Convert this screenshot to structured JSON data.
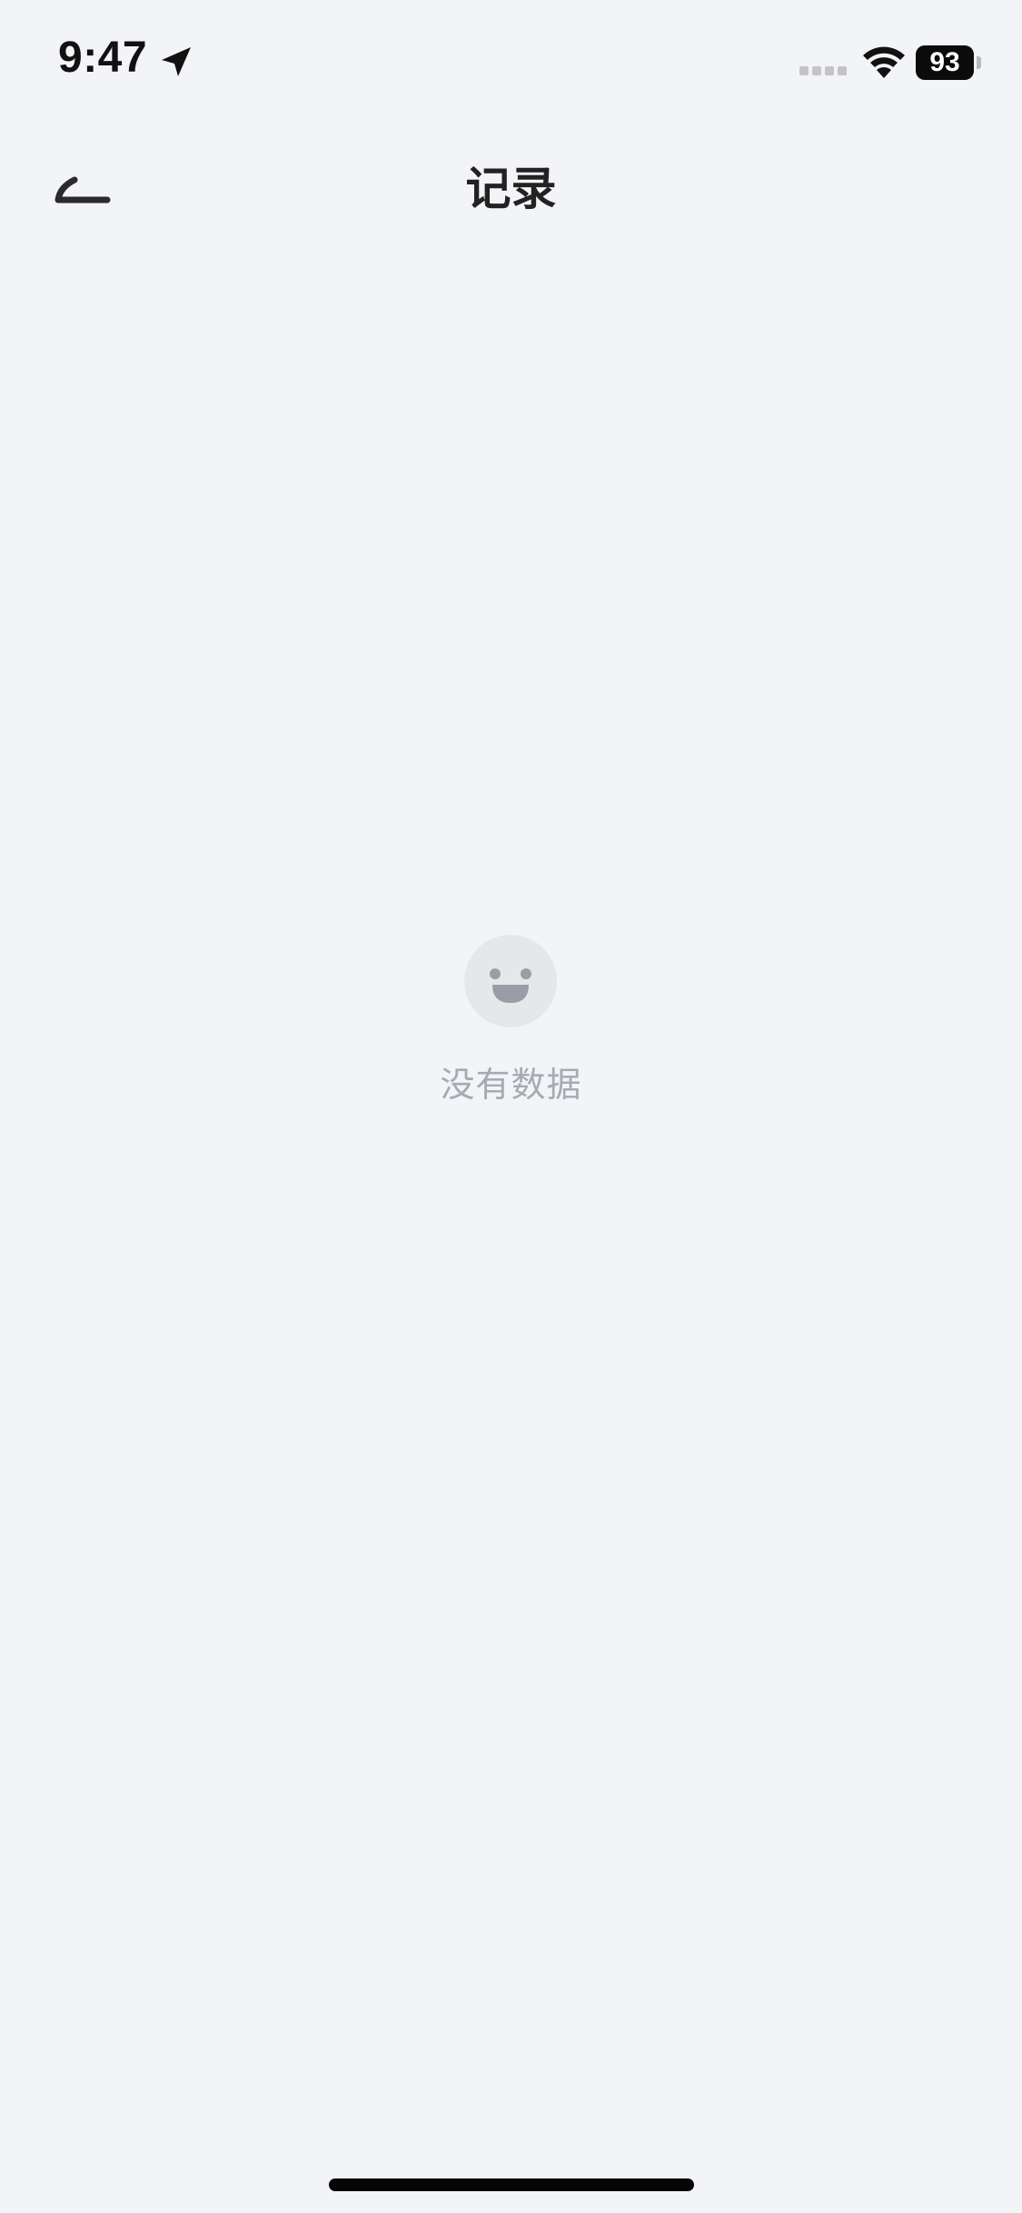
{
  "status_bar": {
    "time": "9:47",
    "battery_level": "93",
    "icons": [
      "location-arrow-icon",
      "cellular-signal-icon",
      "wifi-icon",
      "battery-icon"
    ]
  },
  "nav": {
    "title": "记录",
    "back_icon": "back-arrow-icon"
  },
  "empty_state": {
    "icon": "smiley-face-icon",
    "message": "没有数据"
  },
  "colors": {
    "background": "#f3f4f7",
    "title_text": "#222222",
    "empty_text": "#a7aab2",
    "empty_icon_bg": "#e6e7ea",
    "empty_icon_face": "#9a9da6"
  }
}
